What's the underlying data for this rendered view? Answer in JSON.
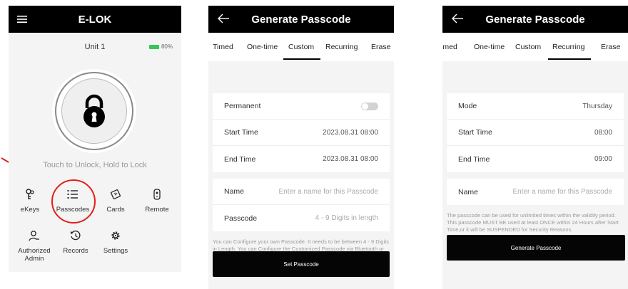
{
  "screen1": {
    "title": "E-LOK",
    "unit": "Unit 1",
    "battery": "80%",
    "hint": "Touch to Unlock, Hold to Lock",
    "menu": [
      {
        "label": "eKeys",
        "icon": "ekey-icon"
      },
      {
        "label": "Passcodes",
        "icon": "passcode-list-icon"
      },
      {
        "label": "Cards",
        "icon": "card-icon"
      },
      {
        "label": "Remote",
        "icon": "remote-icon"
      },
      {
        "label": "Authorized Admin",
        "icon": "admin-icon"
      },
      {
        "label": "Records",
        "icon": "history-icon"
      },
      {
        "label": "Settings",
        "icon": "gear-icon"
      }
    ],
    "annotation_color": "#e0201c"
  },
  "screen2": {
    "title": "Generate Passcode",
    "tabs": [
      "Timed",
      "One-time",
      "Custom",
      "Recurring",
      "Erase"
    ],
    "active_tab": "Custom",
    "permanent_label": "Permanent",
    "start_label": "Start Time",
    "start_value": "2023.08.31 08:00",
    "end_label": "End Time",
    "end_value": "2023.08.31 08:00",
    "name_label": "Name",
    "name_placeholder": "Enter a name for this Passcode",
    "passcode_label": "Passcode",
    "passcode_placeholder": "4 - 9 Digits in length",
    "note": "You can Configure your own Passcode. It needs to be between 4 - 9 Digits in Length. You can Configure the Customized Passcode via Bluetooth or Remotely via a Gateway.",
    "button": "Set Passcode"
  },
  "screen3": {
    "title": "Generate Passcode",
    "tabs": [
      "Timed",
      "One-time",
      "Custom",
      "Recurring",
      "Erase"
    ],
    "active_tab": "Recurring",
    "mode_label": "Mode",
    "mode_value": "Thursday",
    "start_label": "Start Time",
    "start_value": "08:00",
    "end_label": "End Time",
    "end_value": "09:00",
    "name_label": "Name",
    "name_placeholder": "Enter a name for this Passcode",
    "note1": "The passcode can be used for unlimited times within the validity period.",
    "note2": "This passcode MUST BE used at least ONCE within 24 Hours after Start Time,or it will be SUSPENDED for Security Reasons.",
    "button": "Generate Passcode"
  }
}
